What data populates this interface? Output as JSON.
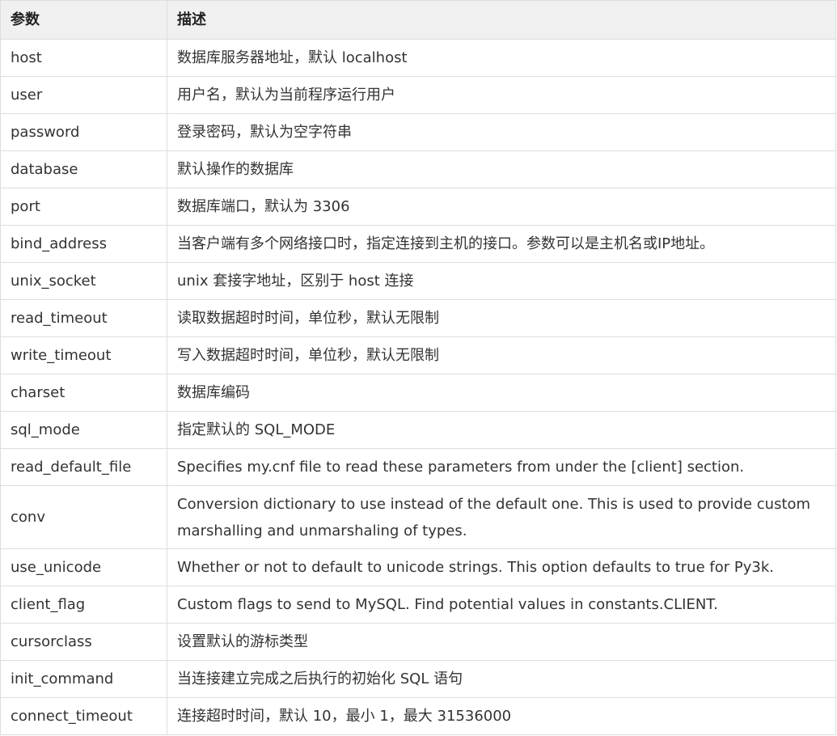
{
  "table": {
    "headers": {
      "param": "参数",
      "desc": "描述"
    },
    "rows": [
      {
        "param": "host",
        "desc": "数据库服务器地址，默认 localhost"
      },
      {
        "param": "user",
        "desc": "用户名，默认为当前程序运行用户"
      },
      {
        "param": "password",
        "desc": "登录密码，默认为空字符串"
      },
      {
        "param": "database",
        "desc": "默认操作的数据库"
      },
      {
        "param": "port",
        "desc": "数据库端口，默认为 3306"
      },
      {
        "param": "bind_address",
        "desc": "当客户端有多个网络接口时，指定连接到主机的接口。参数可以是主机名或IP地址。"
      },
      {
        "param": "unix_socket",
        "desc": "unix 套接字地址，区别于 host 连接"
      },
      {
        "param": "read_timeout",
        "desc": "读取数据超时时间，单位秒，默认无限制"
      },
      {
        "param": "write_timeout",
        "desc": "写入数据超时时间，单位秒，默认无限制"
      },
      {
        "param": "charset",
        "desc": "数据库编码"
      },
      {
        "param": "sql_mode",
        "desc": "指定默认的 SQL_MODE"
      },
      {
        "param": "read_default_file",
        "desc": "Specifies my.cnf file to read these parameters from under the [client] section."
      },
      {
        "param": "conv",
        "desc": "Conversion dictionary to use instead of the default one. This is used to provide custom marshalling and unmarshaling of types."
      },
      {
        "param": "use_unicode",
        "desc": "Whether or not to default to unicode strings. This option defaults to true for Py3k."
      },
      {
        "param": "client_flag",
        "desc": "Custom flags to send to MySQL. Find potential values in constants.CLIENT."
      },
      {
        "param": "cursorclass",
        "desc": "设置默认的游标类型"
      },
      {
        "param": "init_command",
        "desc": "当连接建立完成之后执行的初始化 SQL 语句"
      },
      {
        "param": "connect_timeout",
        "desc": "连接超时时间，默认 10，最小 1，最大 31536000"
      }
    ]
  }
}
